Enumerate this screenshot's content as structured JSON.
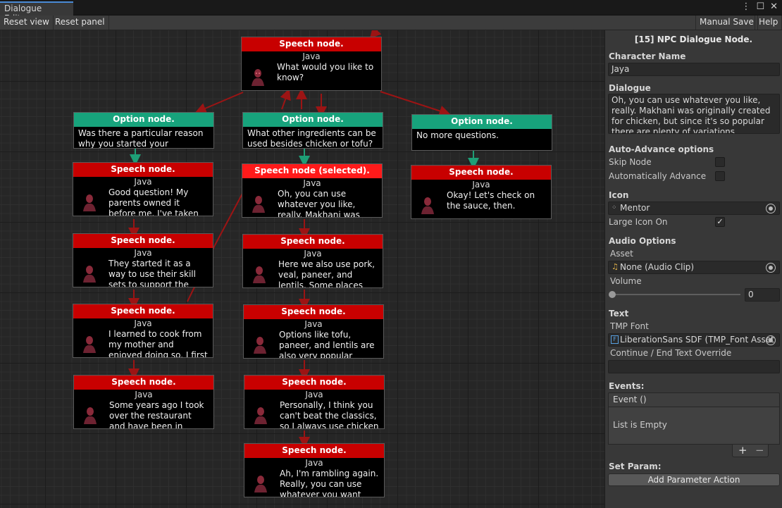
{
  "window": {
    "tab": "Dialogue Editor"
  },
  "toolbar": {
    "reset_view": "Reset view",
    "reset_panel": "Reset panel",
    "manual_save": "Manual Save",
    "help": "Help"
  },
  "colors": {
    "speech": "#c80000",
    "speech_selected": "#ff1a1a",
    "option": "#17a37c",
    "wire_red": "#9c1414",
    "wire_green": "#1e9e76"
  },
  "nodes": [
    {
      "type": "speech",
      "header": "Speech node.",
      "character": "Java",
      "text": "What would you like to know?"
    },
    {
      "type": "option",
      "header": "Option node.",
      "text": "Was there a particular reason why you started your restaurant?"
    },
    {
      "type": "option",
      "header": "Option node.",
      "text": "What other ingredients can be used besides chicken or tofu?"
    },
    {
      "type": "option",
      "header": "Option node.",
      "text": "No more questions."
    },
    {
      "type": "speech",
      "header": "Speech node.",
      "character": "Java",
      "text": "Good question! My parents owned it before me. I've taken over"
    },
    {
      "type": "speech",
      "header": "Speech node (selected).",
      "character": "Java",
      "text": "Oh, you can use whatever you like, really. Makhani was originally"
    },
    {
      "type": "speech",
      "header": "Speech node.",
      "character": "Java",
      "text": "Okay! Let's check on the sauce, then."
    },
    {
      "type": "speech",
      "header": "Speech node.",
      "character": "Java",
      "text": "They started it as a way to use their skill sets to support the family after"
    },
    {
      "type": "speech",
      "header": "Speech node.",
      "character": "Java",
      "text": "Here we also use pork, veal, paneer, and lentils. Some places use beef as"
    },
    {
      "type": "speech",
      "header": "Speech node.",
      "character": "Java",
      "text": "I learned to cook from my mother and enjoyed doing so. I first learned to help"
    },
    {
      "type": "speech",
      "header": "Speech node.",
      "character": "Java",
      "text": "Options like tofu, paneer, and lentils are also very popular because many"
    },
    {
      "type": "speech",
      "header": "Speech node.",
      "character": "Java",
      "text": "Some years ago I took over the restaurant and have been in charge ever"
    },
    {
      "type": "speech",
      "header": "Speech node.",
      "character": "Java",
      "text": "Personally, I think you can't beat the classics, so I always use chicken for"
    },
    {
      "type": "speech",
      "header": "Speech node.",
      "character": "Java",
      "text": "Ah, I'm rambling again. Really, you can use whatever you want"
    }
  ],
  "inspector": {
    "title": "[15] NPC Dialogue Node.",
    "character_name_label": "Character Name",
    "character_name": "Jaya",
    "dialogue_label": "Dialogue",
    "dialogue": "Oh, you can use whatever you like, really. Makhani was originally created for chicken, but since it's so popular there are plenty of variations.",
    "auto_advance_label": "Auto-Advance options",
    "skip_node_label": "Skip Node",
    "auto_advance_checkbox_label": "Automatically Advance",
    "icon_label": "Icon",
    "icon_value": "Mentor",
    "large_icon_label": "Large Icon On",
    "audio_label": "Audio Options",
    "asset_label": "Asset",
    "asset_value": "None (Audio Clip)",
    "volume_label": "Volume",
    "volume_value": "0",
    "volume_level": 0,
    "text_label": "Text",
    "tmp_font_label": "TMP Font",
    "tmp_font_value": "LiberationSans SDF (TMP_Font Asset",
    "continue_label": "Continue / End Text Override",
    "continue_value": "",
    "events_label": "Events:",
    "event_header": "Event ()",
    "list_empty": "List is Empty",
    "plus": "+",
    "minus": "−",
    "set_param_label": "Set Param:",
    "add_param_button": "Add Parameter Action",
    "skip_node_checked": false,
    "auto_advance_checked": false,
    "large_icon_checked": true
  }
}
